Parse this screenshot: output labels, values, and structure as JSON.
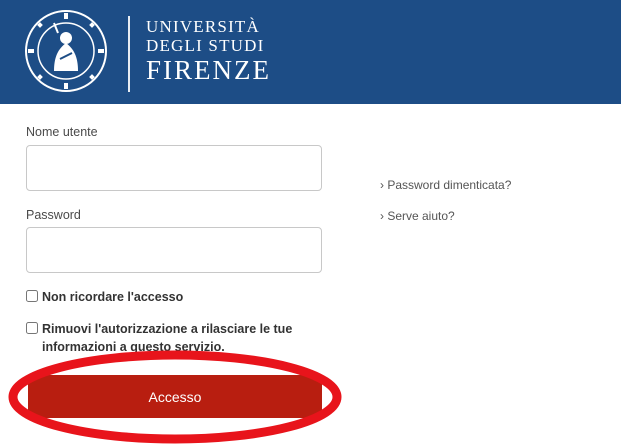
{
  "header": {
    "logo_line1": "UNIVERSITÀ",
    "logo_line2": "DEGLI STUDI",
    "logo_line3": "FIRENZE",
    "seal_text": "FLORENTINA STUDIORUM UNIVERSITAS",
    "background_color": "#1d4d86"
  },
  "form": {
    "username_label": "Nome utente",
    "username_value": "",
    "password_label": "Password",
    "password_value": "",
    "remember_label": "Non ricordare l'accesso",
    "remove_auth_label": "Rimuovi l'autorizzazione a rilasciare le tue informazioni a questo servizio.",
    "submit_label": "Accesso",
    "submit_color": "#b81e10"
  },
  "help_links": {
    "forgot_password": "› Password dimenticata?",
    "need_help": "› Serve aiuto?"
  },
  "annotation": {
    "color": "#e8141b",
    "shape": "ellipse-highlight-around-submit-button"
  }
}
